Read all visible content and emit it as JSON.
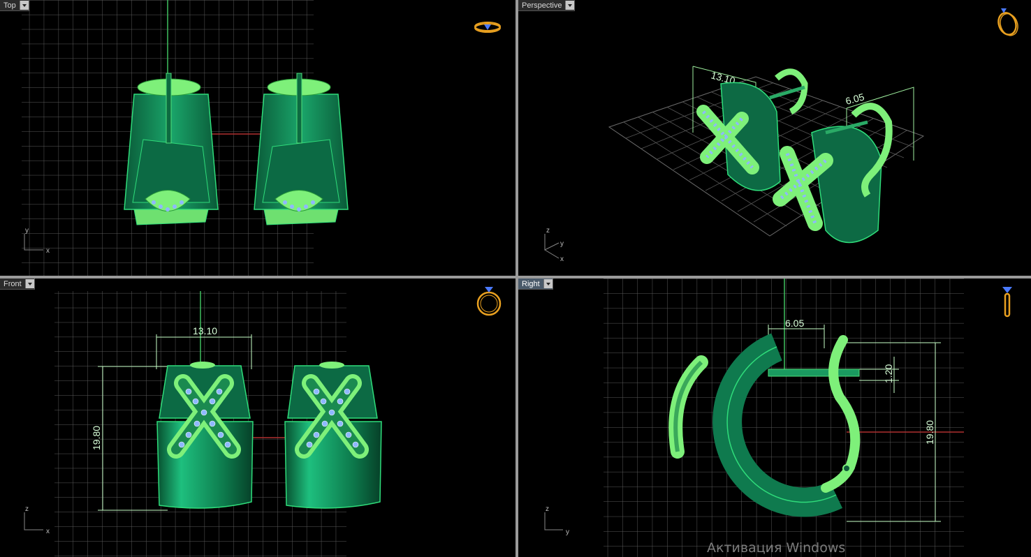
{
  "viewports": {
    "top": {
      "label": "Top",
      "axes": {
        "a": "y",
        "b": "x"
      }
    },
    "perspective": {
      "label": "Perspective",
      "axes": {
        "a": "z",
        "b": "y",
        "c": "x"
      },
      "dims": [
        "13.10",
        "6.05"
      ]
    },
    "front": {
      "label": "Front",
      "axes": {
        "a": "z",
        "b": "x"
      },
      "dims": {
        "width": "13.10",
        "height": "19.80"
      }
    },
    "right": {
      "label": "Right",
      "axes": {
        "a": "z",
        "b": "y"
      },
      "dims": {
        "width": "6.05",
        "pin": "1.20",
        "height": "19.80"
      }
    }
  },
  "watermark": "Активация Windows",
  "colors": {
    "grid": "#5f5f5f",
    "body": "#0f7a4e",
    "accent": "#7ef07a",
    "stones": "#8fb8ff",
    "widget": "#e8a020"
  }
}
